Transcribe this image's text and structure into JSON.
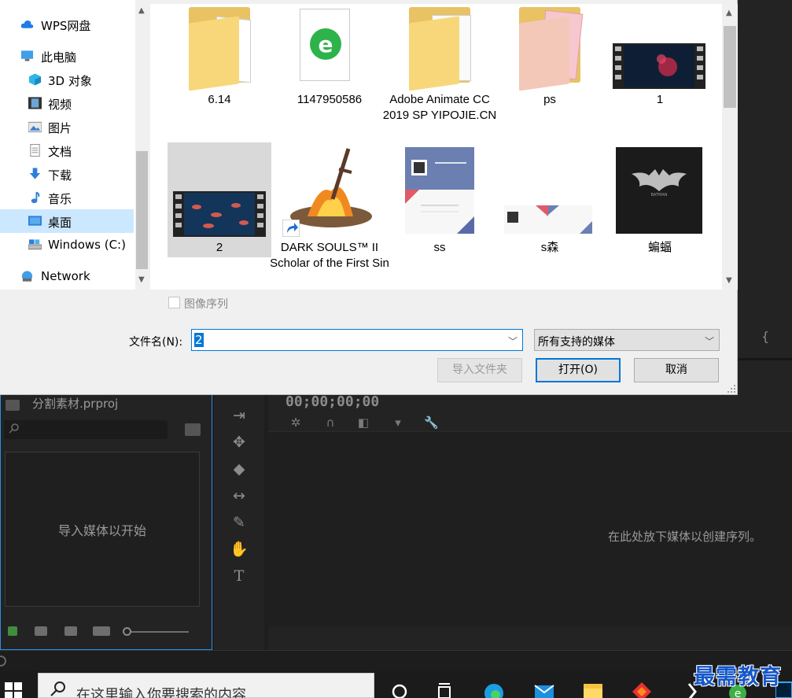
{
  "dialog": {
    "nav_items": [
      {
        "label": "WPS网盘",
        "icon": "cloud-icon"
      },
      {
        "label": "此电脑",
        "icon": "computer-icon"
      },
      {
        "label": "3D 对象",
        "icon": "3d-objects-icon"
      },
      {
        "label": "视频",
        "icon": "video-folder-icon"
      },
      {
        "label": "图片",
        "icon": "pictures-folder-icon"
      },
      {
        "label": "文档",
        "icon": "documents-folder-icon"
      },
      {
        "label": "下载",
        "icon": "download-icon"
      },
      {
        "label": "音乐",
        "icon": "music-icon"
      },
      {
        "label": "桌面",
        "icon": "desktop-icon",
        "selected": true
      },
      {
        "label": "Windows (C:)",
        "icon": "drive-icon"
      },
      {
        "label": "Network",
        "icon": "network-icon"
      }
    ],
    "files": [
      {
        "name": "6.14",
        "type": "folder"
      },
      {
        "name": "1147950586",
        "type": "shortcut-file"
      },
      {
        "name": "Adobe Animate CC 2019 SP YIPOJIE.CN",
        "type": "folder"
      },
      {
        "name": "ps",
        "type": "folder"
      },
      {
        "name": "1",
        "type": "video"
      },
      {
        "name": "2",
        "type": "video",
        "selected": true
      },
      {
        "name": "DARK SOULS™ II Scholar of the First Sin",
        "type": "shortcut"
      },
      {
        "name": "ss",
        "type": "image"
      },
      {
        "name": "s森",
        "type": "image"
      },
      {
        "name": "蝙蝠",
        "type": "image"
      }
    ],
    "image_sequence_label": "图像序列",
    "filename_label": "文件名(N):",
    "filename_value": "2",
    "filetype_value": "所有支持的媒体",
    "import_folder_button": "导入文件夹",
    "open_button": "打开(O)",
    "cancel_button": "取消",
    "accent_color": "#0078d7"
  },
  "premiere": {
    "project_name": "分割素材.prproj",
    "project_empty_text": "导入媒体以开始",
    "timecode": "00;00;00;00",
    "timeline_empty_text": "在此处放下媒体以创建序列。",
    "bracket": "{",
    "accent_color": "#2d8ceb"
  },
  "taskbar": {
    "search_placeholder": "在这里输入你要搜索的内容"
  },
  "watermark": "最需教育"
}
